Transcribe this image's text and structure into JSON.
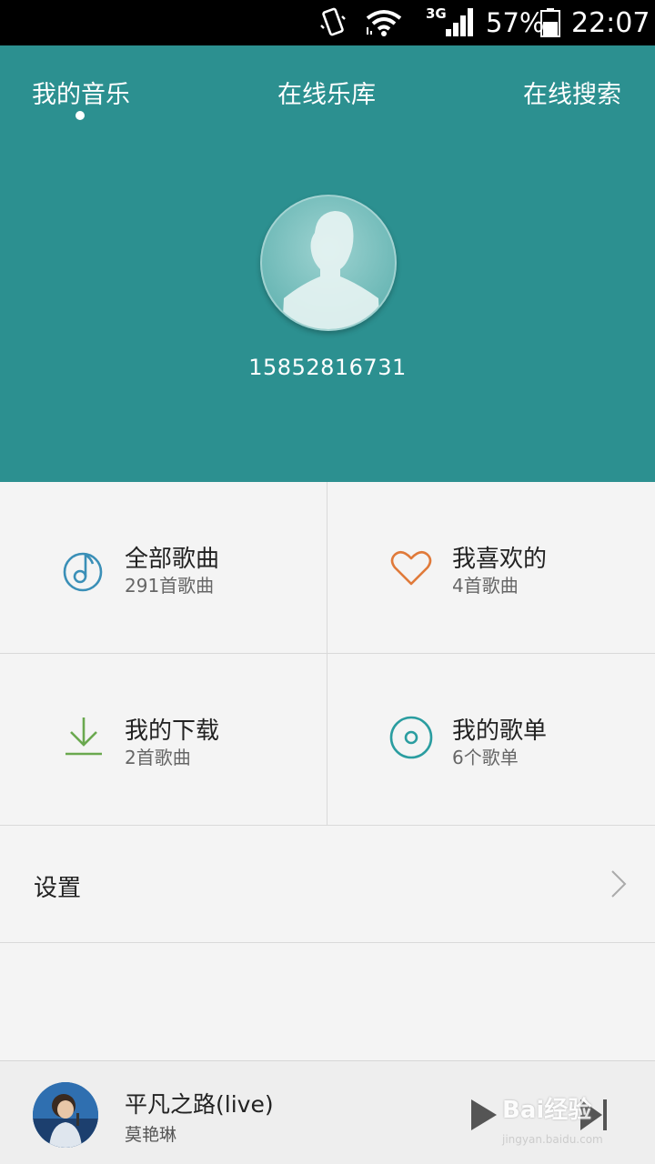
{
  "status_bar": {
    "network_label": "3G",
    "battery_percent": "57%",
    "battery_level": 0.57,
    "time": "22:07"
  },
  "tabs": [
    {
      "label": "我的音乐",
      "active": true
    },
    {
      "label": "在线乐库",
      "active": false
    },
    {
      "label": "在线搜索",
      "active": false
    }
  ],
  "profile": {
    "phone": "15852816731"
  },
  "grid": [
    {
      "title": "全部歌曲",
      "subtitle": "291首歌曲",
      "icon": "music-note-icon",
      "color": "#3a8fb7"
    },
    {
      "title": "我喜欢的",
      "subtitle": "4首歌曲",
      "icon": "heart-icon",
      "color": "#e07a3a"
    },
    {
      "title": "我的下载",
      "subtitle": "2首歌曲",
      "icon": "download-icon",
      "color": "#6aa84f"
    },
    {
      "title": "我的歌单",
      "subtitle": "6个歌单",
      "icon": "disc-icon",
      "color": "#2a9da0"
    }
  ],
  "settings": {
    "label": "设置"
  },
  "player": {
    "song": "平凡之路(live)",
    "artist": "莫艳琳"
  },
  "watermark": {
    "text": "Bai经验",
    "sub": "jingyan.baidu.com"
  },
  "colors": {
    "header": "#2c9090",
    "background": "#f4f4f4"
  }
}
